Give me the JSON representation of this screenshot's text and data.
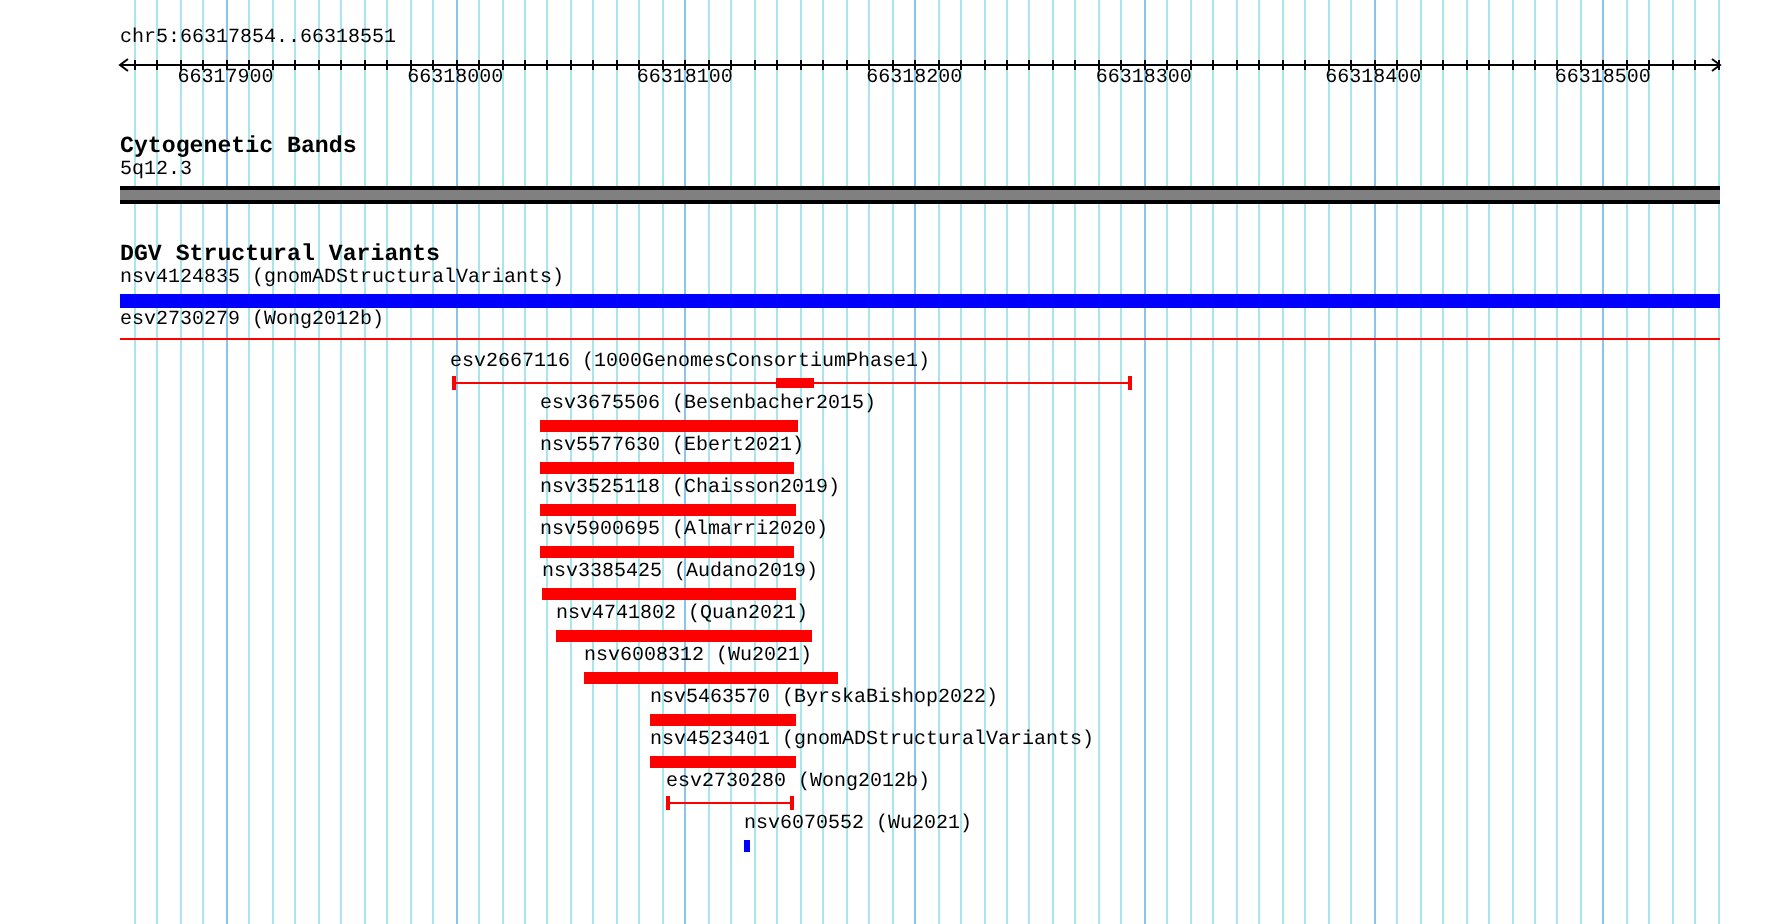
{
  "location": "chr5:66317854..66318551",
  "ruler": {
    "ticks": [
      "66317900",
      "66318000",
      "66318100",
      "66318200",
      "66318300",
      "66318400",
      "66318500"
    ]
  },
  "tracks": [
    {
      "title": "Cytogenetic Bands",
      "features": [
        {
          "label": "5q12.3",
          "kind": "cytoband"
        }
      ]
    },
    {
      "title": "DGV Structural Variants",
      "features": [
        {
          "label": "nsv4124835 (gnomADStructuralVariants)",
          "kind": "bar",
          "color": "#0000ff"
        },
        {
          "label": "esv2730279 (Wong2012b)",
          "kind": "line",
          "color": "#ff0000"
        },
        {
          "label": "esv2667116 (1000GenomesConsortiumPhase1)",
          "kind": "range_core",
          "color": "#ff0000"
        },
        {
          "label": "esv3675506 (Besenbacher2015)",
          "kind": "bar",
          "color": "#ff0000"
        },
        {
          "label": "nsv5577630 (Ebert2021)",
          "kind": "bar",
          "color": "#ff0000"
        },
        {
          "label": "nsv3525118 (Chaisson2019)",
          "kind": "bar",
          "color": "#ff0000"
        },
        {
          "label": "nsv5900695 (Almarri2020)",
          "kind": "bar",
          "color": "#ff0000"
        },
        {
          "label": "nsv3385425 (Audano2019)",
          "kind": "bar",
          "color": "#ff0000"
        },
        {
          "label": "nsv4741802 (Quan2021)",
          "kind": "bar",
          "color": "#ff0000"
        },
        {
          "label": "nsv6008312 (Wu2021)",
          "kind": "bar",
          "color": "#ff0000"
        },
        {
          "label": "nsv5463570 (ByrskaBishop2022)",
          "kind": "bar",
          "color": "#ff0000"
        },
        {
          "label": "nsv4523401 (gnomADStructuralVariants)",
          "kind": "bar",
          "color": "#ff0000"
        },
        {
          "label": "esv2730280 (Wong2012b)",
          "kind": "range",
          "color": "#ff0000"
        },
        {
          "label": "nsv6070552 (Wu2021)",
          "kind": "bar",
          "color": "#0000ff"
        }
      ]
    }
  ]
}
